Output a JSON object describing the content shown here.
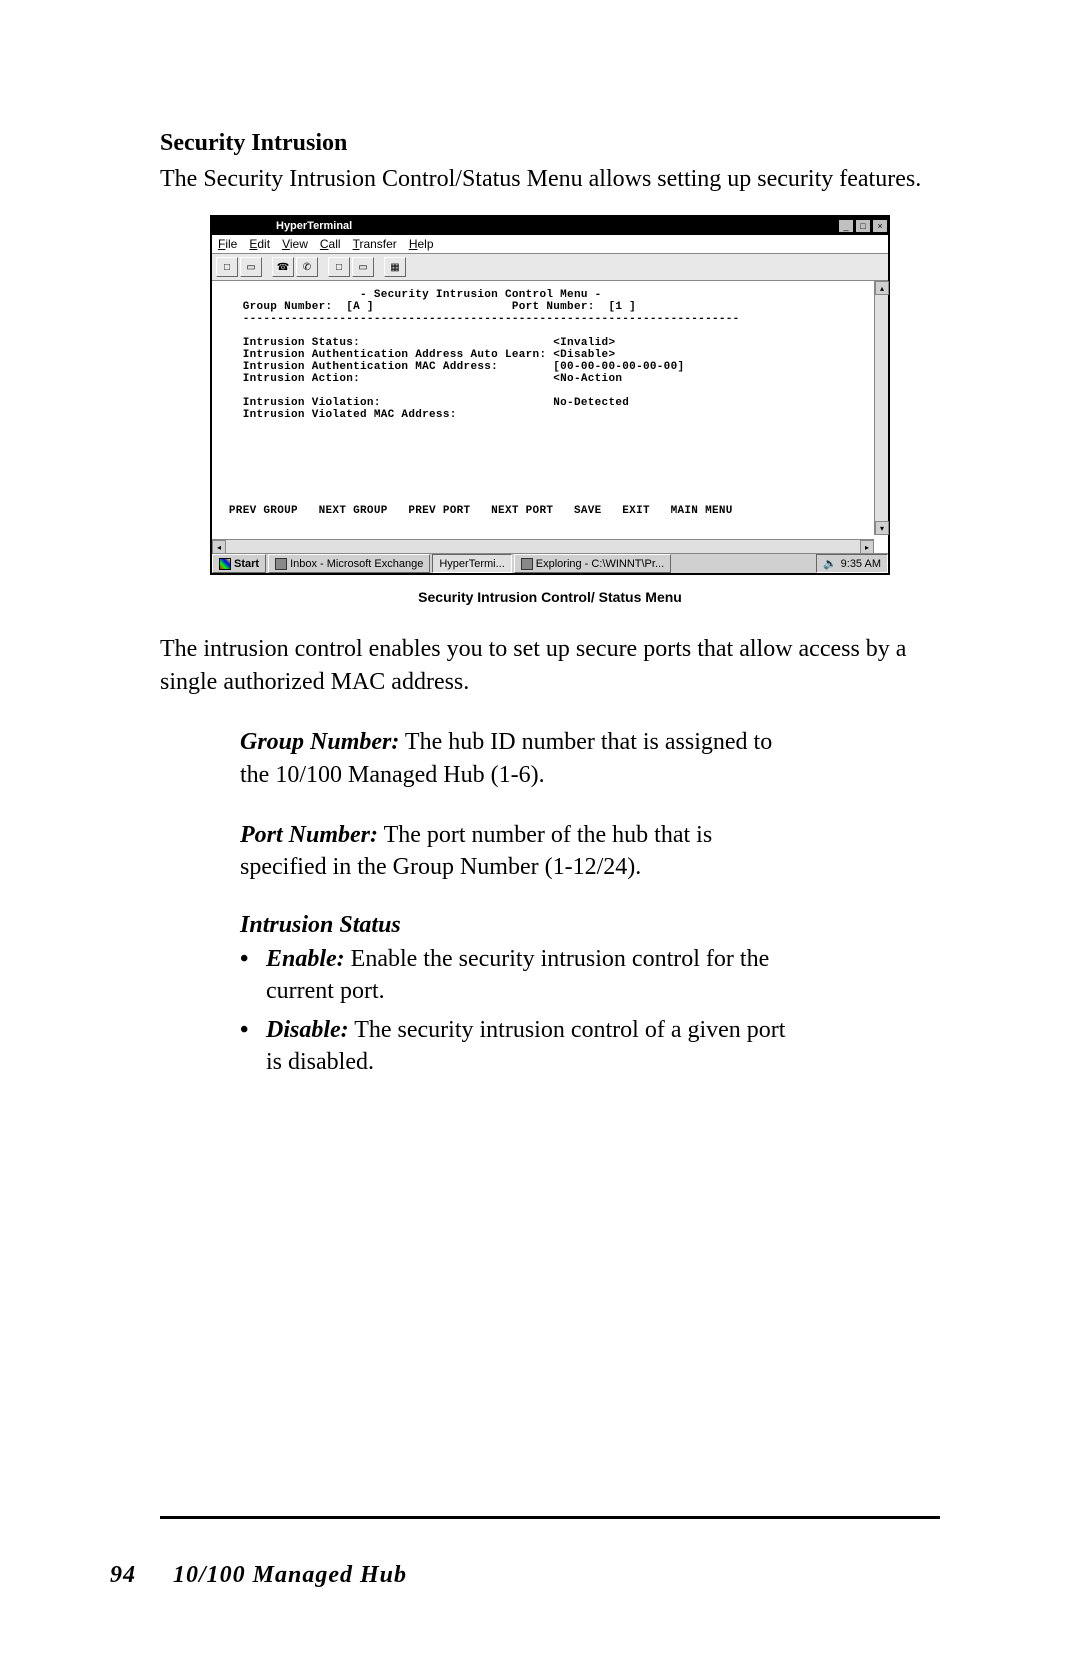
{
  "section_title": "Security Intrusion",
  "intro": "The Security Intrusion Control/Status Menu allows setting up security features.",
  "window": {
    "title": "HyperTerminal",
    "menubar": [
      "File",
      "Edit",
      "View",
      "Call",
      "Transfer",
      "Help"
    ],
    "toolbar_icons": [
      "new-file-icon",
      "open-icon",
      "call-icon",
      "hangup-icon",
      "send-icon",
      "receive-icon",
      "properties-icon"
    ],
    "terminal": {
      "header": "- Security Intrusion Control Menu -",
      "group_label": "Group Number:",
      "group_value": "[A ]",
      "port_label": "Port Number:",
      "port_value": "[1 ]",
      "separator": "------------------------------------------------------------------------",
      "rows": [
        {
          "label": "Intrusion Status:",
          "value": "<Invalid>"
        },
        {
          "label": "Intrusion Authentication Address Auto Learn:",
          "value": "<Disable>"
        },
        {
          "label": "Intrusion Authentication MAC Address:",
          "value": "[00-00-00-00-00-00]"
        },
        {
          "label": "Intrusion Action:",
          "value": "<No-Action"
        }
      ],
      "rows2": [
        {
          "label": "Intrusion Violation:",
          "value": "No-Detected"
        },
        {
          "label": "Intrusion Violated MAC Address:",
          "value": ""
        }
      ],
      "nav": [
        "PREV GROUP",
        "NEXT GROUP",
        "PREV PORT",
        "NEXT PORT",
        "SAVE",
        "EXIT",
        "MAIN MENU"
      ]
    },
    "taskbar": {
      "start": "Start",
      "tasks": [
        {
          "label": "Inbox - Microsoft Exchange"
        },
        {
          "label": "HyperTermi..."
        },
        {
          "label": "Exploring - C:\\WINNT\\Pr..."
        }
      ],
      "time": "9:35 AM"
    }
  },
  "caption": "Security Intrusion Control/ Status Menu",
  "post_text": "The intrusion control enables you to set up secure ports that allow access by a single authorized MAC address.",
  "defs": {
    "group": {
      "term": "Group Number:",
      "text": " The hub ID number that is assigned to the 10/100 Managed Hub (1-6)."
    },
    "port": {
      "term": "Port Number:",
      "text": " The port number of the hub that is specified in the Group Number (1-12/24)."
    }
  },
  "intrusion_status": {
    "heading": "Intrusion Status",
    "items": [
      {
        "term": "Enable:",
        "text": " Enable the security intrusion control for the current port."
      },
      {
        "term": "Disable:",
        "text": " The security intrusion control of a given port is disabled."
      }
    ]
  },
  "footer": {
    "page": "94",
    "title": "10/100 Managed Hub"
  }
}
